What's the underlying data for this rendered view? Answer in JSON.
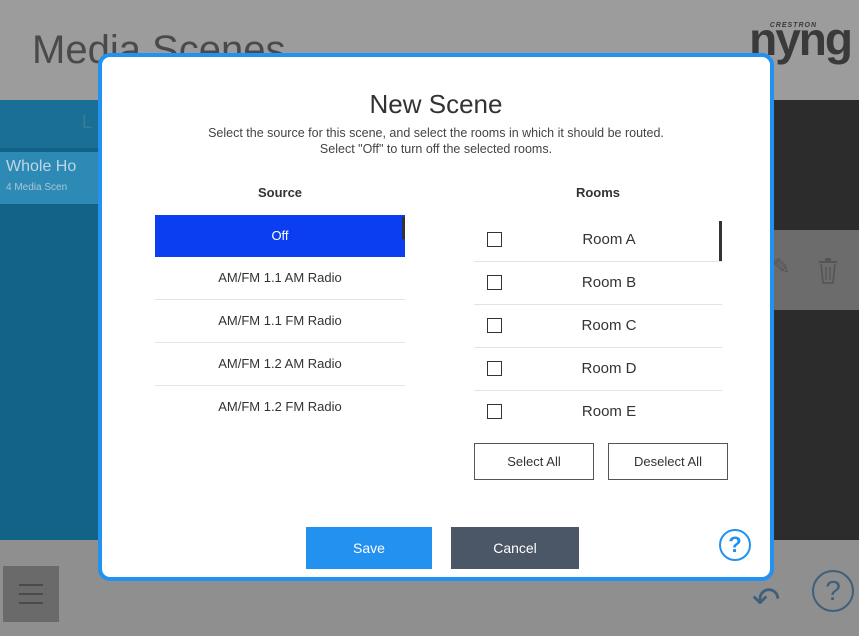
{
  "app": {
    "title": "Media Scenes",
    "brand_top": "CRESTRON",
    "brand_main": "nyng",
    "left_tab_label": "L",
    "left_item": {
      "title": "Whole Ho",
      "subtitle": "4 Media Scen"
    }
  },
  "modal": {
    "title": "New Scene",
    "subtitle_line1": "Select the source for this scene, and select the rooms in which it should be routed.",
    "subtitle_line2": "Select \"Off\" to turn off the selected rooms.",
    "source_header": "Source",
    "rooms_header": "Rooms",
    "sources": [
      {
        "label": "Off",
        "selected": true
      },
      {
        "label": "AM/FM 1.1 AM Radio",
        "selected": false
      },
      {
        "label": "AM/FM 1.1 FM Radio",
        "selected": false
      },
      {
        "label": "AM/FM 1.2 AM Radio",
        "selected": false
      },
      {
        "label": "AM/FM 1.2 FM Radio",
        "selected": false
      }
    ],
    "rooms": [
      {
        "label": "Room A",
        "checked": false
      },
      {
        "label": "Room B",
        "checked": false
      },
      {
        "label": "Room C",
        "checked": false
      },
      {
        "label": "Room D",
        "checked": false
      },
      {
        "label": "Room E",
        "checked": false
      }
    ],
    "select_all_label": "Select All",
    "deselect_all_label": "Deselect All",
    "save_label": "Save",
    "cancel_label": "Cancel",
    "help_glyph": "?"
  },
  "footer": {
    "help_glyph": "?"
  },
  "colors": {
    "accent": "#2291f0",
    "selected": "#0a3ef0",
    "cancel": "#4b5766"
  },
  "icons": [
    "menu-icon",
    "back-icon",
    "help-icon",
    "trash-icon",
    "edit-icon"
  ]
}
